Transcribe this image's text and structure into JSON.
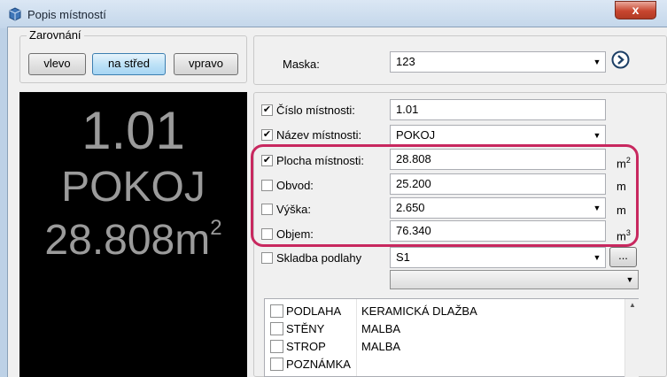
{
  "window": {
    "title": "Popis místností",
    "close_glyph": "x"
  },
  "alignment": {
    "group_label": "Zarovnání",
    "buttons": [
      "vlevo",
      "na střed",
      "vpravo"
    ],
    "active_index": 1
  },
  "mask": {
    "label": "Maska:",
    "value": "123",
    "go_icon": "circle-arrow-right-icon"
  },
  "preview": {
    "room_number": "1.01",
    "room_name": "POKOJ",
    "area_value": "28.808m",
    "area_exponent": "2",
    "background": "#000000",
    "text_color": "#9b9b9b"
  },
  "properties": [
    {
      "label": "Číslo místnosti:",
      "checked": true,
      "value": "1.01",
      "control": "text",
      "unit": "",
      "unit_exp": ""
    },
    {
      "label": "Název místnosti:",
      "checked": true,
      "value": "POKOJ",
      "control": "combo",
      "unit": "",
      "unit_exp": ""
    },
    {
      "label": "Plocha místnosti:",
      "checked": true,
      "value": "28.808",
      "control": "text",
      "unit": "m",
      "unit_exp": "2"
    },
    {
      "label": "Obvod:",
      "checked": false,
      "value": "25.200",
      "control": "text",
      "unit": "m",
      "unit_exp": ""
    },
    {
      "label": "Výška:",
      "checked": false,
      "value": "2.650",
      "control": "combo",
      "unit": "m",
      "unit_exp": ""
    },
    {
      "label": "Objem:",
      "checked": false,
      "value": "76.340",
      "control": "text",
      "unit": "m",
      "unit_exp": "3"
    }
  ],
  "floor": {
    "label": "Skladba podlahy",
    "checked": false,
    "value": "S1",
    "browse_label": "...",
    "second_combo_value": ""
  },
  "composition": [
    {
      "name": "PODLAHA",
      "value": "KERAMICKÁ DLAŽBA",
      "checked": false
    },
    {
      "name": "STĚNY",
      "value": "MALBA",
      "checked": false
    },
    {
      "name": "STROP",
      "value": "MALBA",
      "checked": false
    },
    {
      "name": "POZNÁMKA",
      "value": "",
      "checked": false
    }
  ],
  "colors": {
    "highlight": "#c8285f",
    "active_button": "#bfe2f7"
  }
}
